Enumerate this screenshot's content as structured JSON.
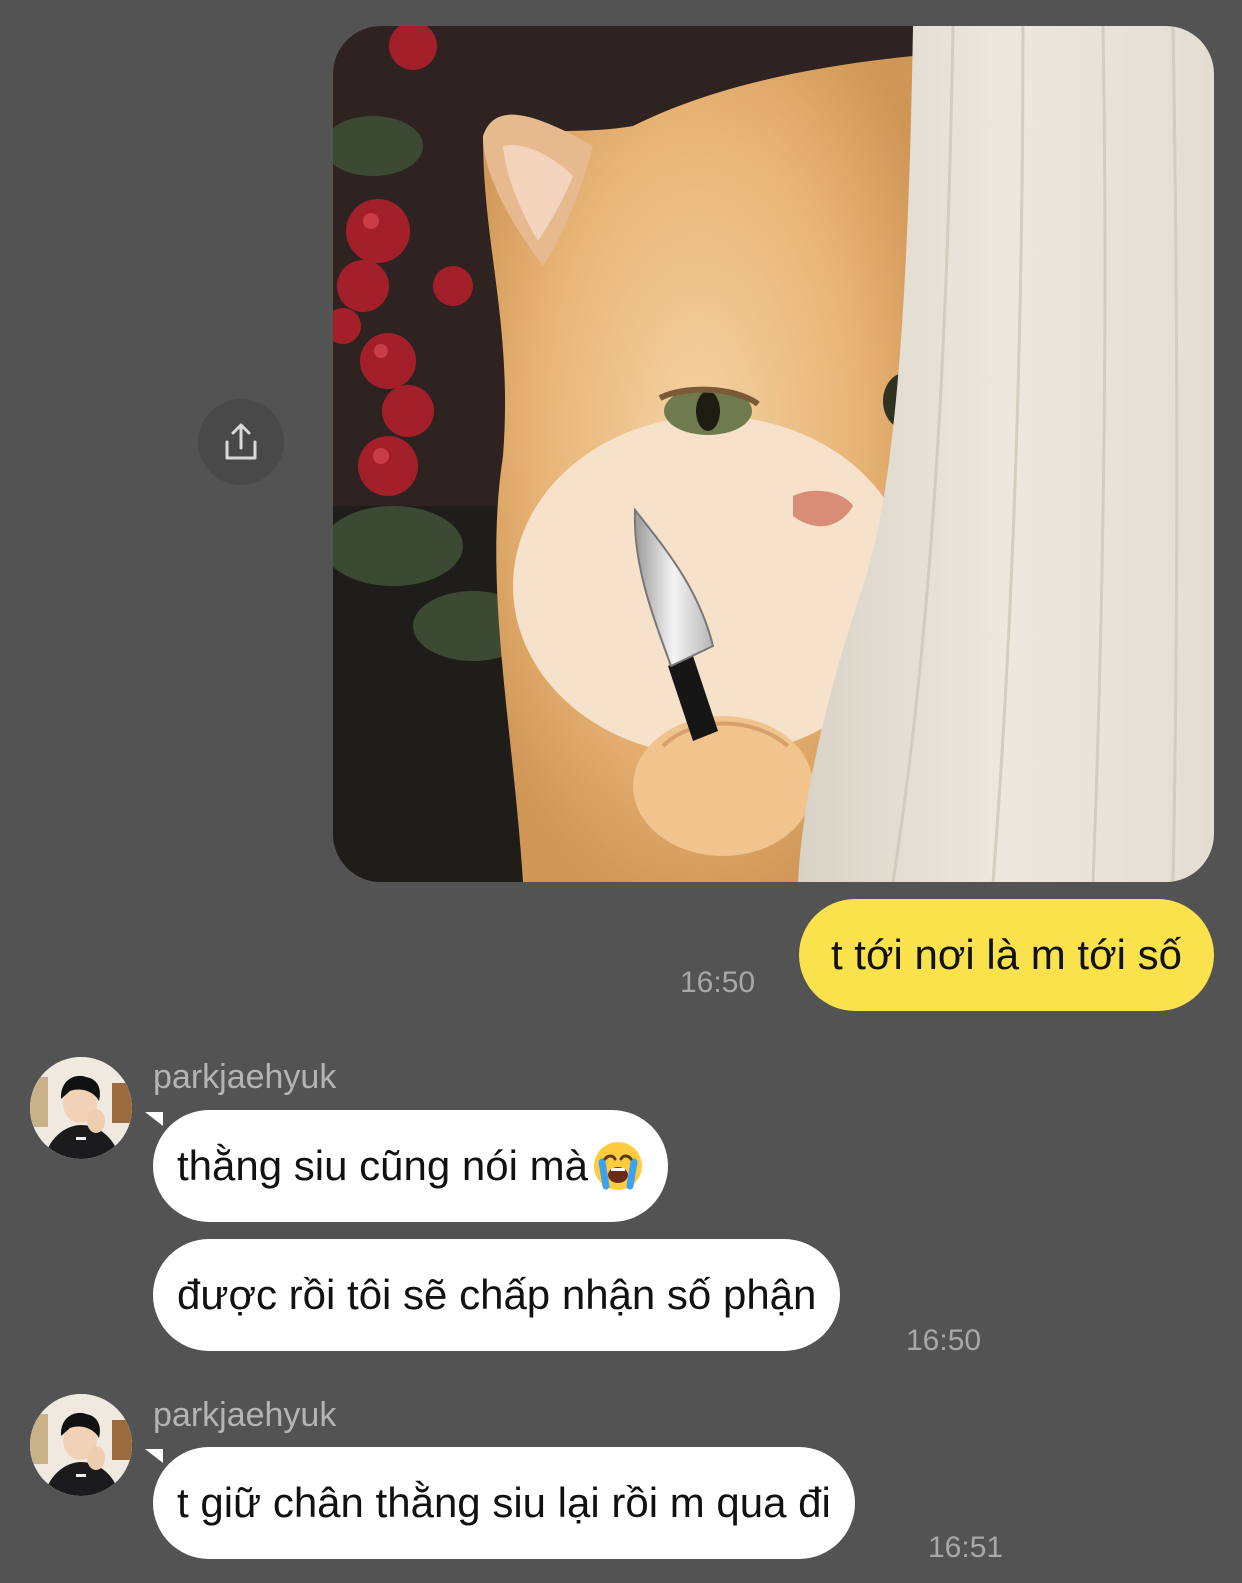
{
  "colors": {
    "background": "#545354",
    "outgoing_bubble": "#f9e24b",
    "incoming_bubble": "#ffffff",
    "timestamp": "#a8a7a9",
    "sender_name": "#b4b3b5"
  },
  "share_button": {
    "icon": "share-upload-icon"
  },
  "photo_message": {
    "image": "cat-holding-knife-photo"
  },
  "messages": [
    {
      "direction": "outgoing",
      "text": "t tới nơi là m tới số",
      "time": "16:50"
    },
    {
      "direction": "incoming",
      "sender": "parkjaehyuk",
      "text": "thằng siu cũng nói mà",
      "emoji": "loudly-crying-face-emoji"
    },
    {
      "direction": "incoming",
      "text": "được rồi tôi sẽ chấp nhận số phận",
      "time": "16:50"
    },
    {
      "direction": "incoming",
      "sender": "parkjaehyuk",
      "text": "t giữ chân thằng siu lại rồi m qua đi",
      "time": "16:51"
    }
  ]
}
